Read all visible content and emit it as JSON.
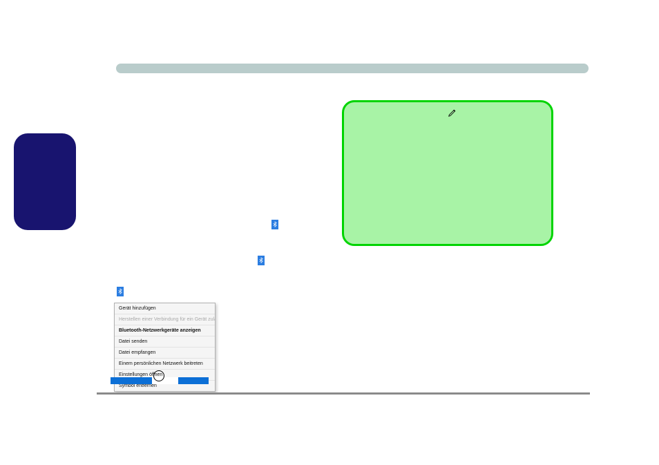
{
  "context_menu": {
    "items": [
      {
        "label": "Gerät hinzufügen",
        "disabled": false,
        "bold": false
      },
      {
        "label": "Herstellen einer Verbindung für ein Gerät zulassen",
        "disabled": true,
        "bold": false
      },
      {
        "label": "Bluetooth-Netzwerkgeräte anzeigen",
        "disabled": false,
        "bold": true
      },
      {
        "label": "Datei senden",
        "disabled": false,
        "bold": false
      },
      {
        "label": "Datei empfangen",
        "disabled": false,
        "bold": false
      },
      {
        "label": "Einem persönlichen Netzwerk beitreten",
        "disabled": false,
        "bold": false
      },
      {
        "label": "Einstellungen öffnen",
        "disabled": false,
        "bold": false
      },
      {
        "label": "Symbol entfernen",
        "disabled": false,
        "bold": false
      }
    ]
  },
  "icons": {
    "edit": "pen",
    "bluetooth": "bluetooth"
  }
}
